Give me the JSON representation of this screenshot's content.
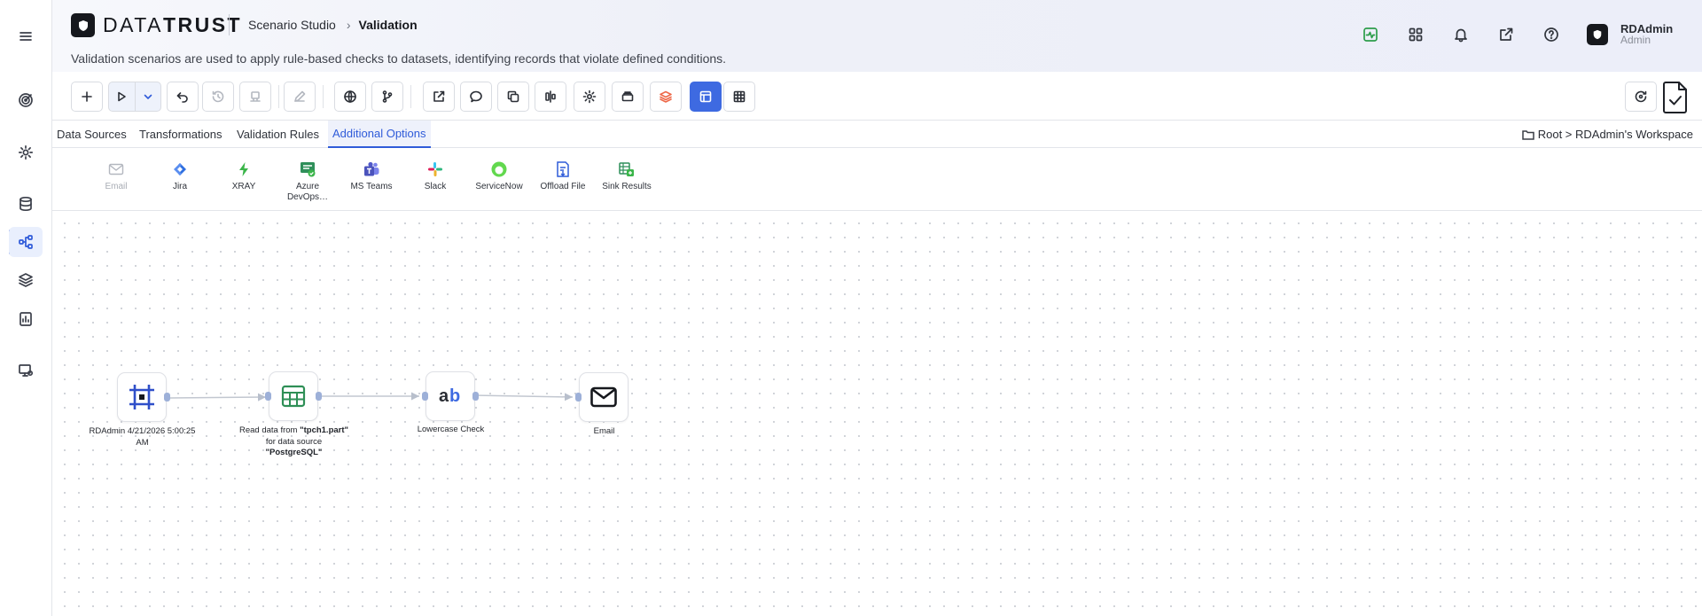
{
  "app": {
    "logo_text_light": "DATA",
    "logo_text_bold": "TRUST",
    "breadcrumb_section": "Scenario Studio",
    "breadcrumb_page": "Validation",
    "subtitle": "Validation scenarios are used to apply rule-based checks to datasets, identifying records that violate defined conditions."
  },
  "user": {
    "name": "RDAdmin",
    "role": "Admin"
  },
  "tabs": [
    {
      "label": "Data Sources",
      "active": false
    },
    {
      "label": "Transformations",
      "active": false
    },
    {
      "label": "Validation Rules",
      "active": false
    },
    {
      "label": "Additional Options",
      "active": true
    }
  ],
  "workspace_path": "Root > RDAdmin's Workspace",
  "palette": [
    {
      "label": "Email",
      "icon": "mail-icon",
      "enabled": false
    },
    {
      "label": "Jira",
      "icon": "jira-icon",
      "enabled": true
    },
    {
      "label": "XRAY",
      "icon": "xray-icon",
      "enabled": true
    },
    {
      "label": "Azure DevOps…",
      "icon": "azure-devops-icon",
      "enabled": true
    },
    {
      "label": "MS Teams",
      "icon": "ms-teams-icon",
      "enabled": true
    },
    {
      "label": "Slack",
      "icon": "slack-icon",
      "enabled": true
    },
    {
      "label": "ServiceNow",
      "icon": "servicenow-icon",
      "enabled": true
    },
    {
      "label": "Offload File",
      "icon": "offload-file-icon",
      "enabled": true
    },
    {
      "label": "Sink Results",
      "icon": "sink-results-icon",
      "enabled": true
    }
  ],
  "nodes": {
    "start": {
      "label": "RDAdmin 4/21/2026 5:00:25 AM",
      "icon": "frame-icon"
    },
    "read": {
      "label_prefix": "Read data from ",
      "source_name": "\"tpch1.part\"",
      "label_mid": " for data source ",
      "data_source": "\"PostgreSQL\"",
      "icon": "table-icon"
    },
    "lowercase": {
      "label": "Lowercase Check",
      "icon": "ab-text-icon"
    },
    "email": {
      "label": "Email",
      "icon": "mail-icon"
    }
  },
  "colors": {
    "accent": "#2f5bd9",
    "active_toolbar": "#3e6ae1",
    "activity_green": "#2c9d4a",
    "dark": "#16181d"
  }
}
